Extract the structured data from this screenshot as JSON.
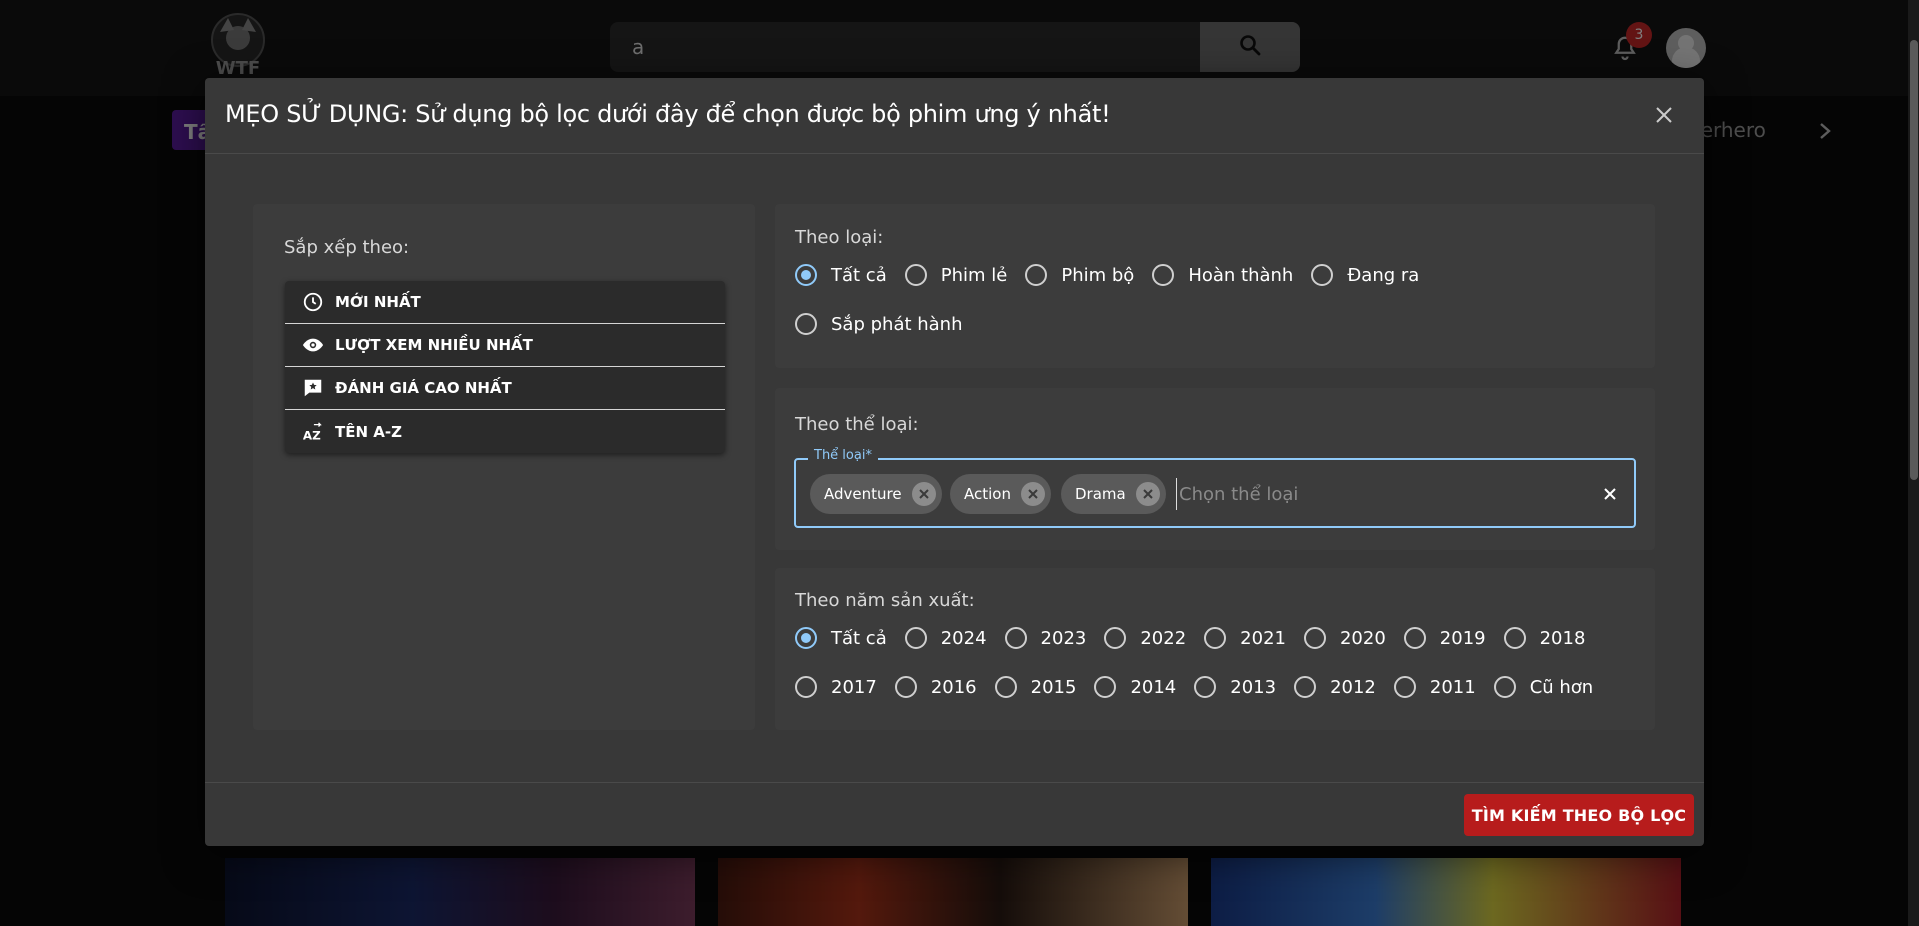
{
  "header": {
    "logo_text": "WTF",
    "search": {
      "value": "a",
      "placeholder": ""
    },
    "notifications_count": "3"
  },
  "categories": {
    "active_partial": "Tất cả",
    "right_partial": "perhero"
  },
  "dialog": {
    "title": "MẸO SỬ DỤNG: Sử dụng bộ lọc dưới đây để chọn được bộ phim ưng ý nhất!",
    "sort": {
      "label": "Sắp xếp theo:",
      "items": [
        {
          "label": "MỚI NHẤT",
          "icon": "clock-icon"
        },
        {
          "label": "LƯỢT XEM NHIỀU NHẤT",
          "icon": "eye-icon"
        },
        {
          "label": "ĐÁNH GIÁ CAO NHẤT",
          "icon": "rate-review-icon"
        },
        {
          "label": "TÊN A-Z",
          "icon": "sort-az-icon"
        }
      ]
    },
    "type": {
      "label": "Theo loại:",
      "options": [
        "Tất cả",
        "Phim lẻ",
        "Phim bộ",
        "Hoàn thành",
        "Đang ra",
        "Sắp phát hành"
      ],
      "selected": "Tất cả"
    },
    "genre": {
      "label": "Theo thể loại:",
      "field_label": "Thể loại*",
      "chips": [
        "Adventure",
        "Action",
        "Drama"
      ],
      "placeholder": "Chọn thể loại"
    },
    "year": {
      "label": "Theo năm sản xuất:",
      "options_row1": [
        "Tất cả",
        "2024",
        "2023",
        "2022",
        "2021",
        "2020",
        "2019",
        "2018"
      ],
      "options_row2": [
        "2017",
        "2016",
        "2015",
        "2014",
        "2013",
        "2012",
        "2011",
        "Cũ hơn"
      ],
      "selected": "Tất cả"
    },
    "apply_label": "TÌM KIẾM THEO BỘ LỌC"
  },
  "colors": {
    "accent": "#90caf9",
    "primary_button": "#b71c1c",
    "category_active": "#5b1d9e",
    "badge": "#c62828"
  }
}
